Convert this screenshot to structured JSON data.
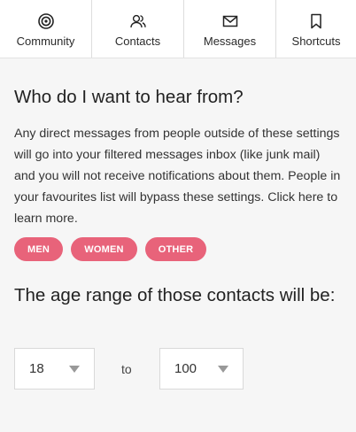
{
  "tabs": [
    {
      "label": "Community",
      "icon": "target-icon"
    },
    {
      "label": "Contacts",
      "icon": "contacts-icon"
    },
    {
      "label": "Messages",
      "icon": "envelope-icon"
    },
    {
      "label": "Shortcuts",
      "icon": "bookmark-icon"
    }
  ],
  "section": {
    "heading": "Who do I want to hear from?",
    "description": "Any direct messages from people outside of these settings will go into your filtered messages inbox (like junk mail) and you will not receive notifications about them. People in your favourites list will bypass these settings. Click here to learn more.",
    "filters": [
      {
        "label": "MEN"
      },
      {
        "label": "WOMEN"
      },
      {
        "label": "OTHER"
      }
    ]
  },
  "age_range": {
    "heading": "The age range of those contacts will be:",
    "min_value": "18",
    "separator": "to",
    "max_value": "100"
  },
  "colors": {
    "accent": "#e8637a",
    "background": "#f6f6f6"
  }
}
